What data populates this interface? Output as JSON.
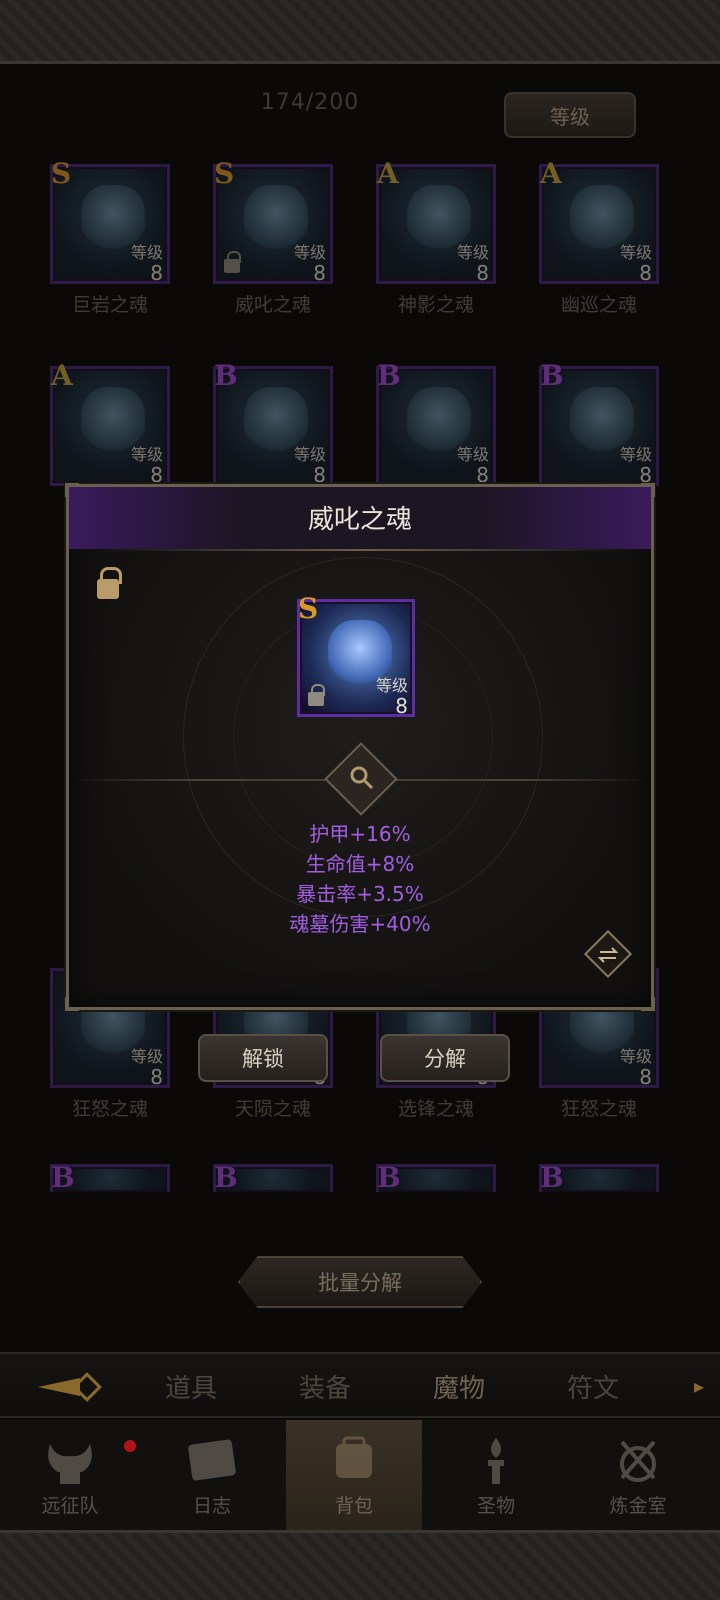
{
  "header": {
    "count": "174/200",
    "sort_label": "等级"
  },
  "grid": {
    "rows": [
      [
        {
          "rank": "S",
          "level_label": "等级",
          "level": "8",
          "name": "巨岩之魂",
          "locked": false
        },
        {
          "rank": "S",
          "level_label": "等级",
          "level": "8",
          "name": "威叱之魂",
          "locked": true
        },
        {
          "rank": "A",
          "level_label": "等级",
          "level": "8",
          "name": "神影之魂",
          "locked": false
        },
        {
          "rank": "A",
          "level_label": "等级",
          "level": "8",
          "name": "幽巡之魂",
          "locked": false
        }
      ],
      [
        {
          "rank": "A",
          "level_label": "等级",
          "level": "8",
          "name": "",
          "locked": false
        },
        {
          "rank": "B",
          "level_label": "等级",
          "level": "8",
          "name": "",
          "locked": false
        },
        {
          "rank": "B",
          "level_label": "等级",
          "level": "8",
          "name": "",
          "locked": false
        },
        {
          "rank": "B",
          "level_label": "等级",
          "level": "8",
          "name": "",
          "locked": false
        }
      ],
      [
        {
          "rank": "",
          "level_label": "等级",
          "level": "8",
          "name": "狂怒之魂",
          "locked": false
        },
        {
          "rank": "",
          "level_label": "",
          "level": "8",
          "name": "天陨之魂",
          "locked": false
        },
        {
          "rank": "",
          "level_label": "",
          "level": "8",
          "name": "选锋之魂",
          "locked": false
        },
        {
          "rank": "",
          "level_label": "等级",
          "level": "8",
          "name": "狂怒之魂",
          "locked": false
        }
      ],
      [
        {
          "rank": "B"
        },
        {
          "rank": "B"
        },
        {
          "rank": "B"
        },
        {
          "rank": "B"
        }
      ]
    ]
  },
  "dialog": {
    "title": "威叱之魂",
    "card": {
      "rank": "S",
      "level_label": "等级",
      "level": "8"
    },
    "stats": [
      "护甲+16%",
      "生命值+8%",
      "暴击率+3.5%",
      "魂墓伤害+40%"
    ]
  },
  "actions": {
    "unlock_label": "解锁",
    "decompose_label": "分解",
    "batch_label": "批量分解"
  },
  "tabs": {
    "items": [
      "道具",
      "装备",
      "魔物",
      "符文"
    ],
    "active": "魔物"
  },
  "nav": {
    "items": [
      "远征队",
      "日志",
      "背包",
      "圣物",
      "炼金室"
    ],
    "active": "背包"
  },
  "colors": {
    "stat": "#a25ee0",
    "rank_s": "#d99a28",
    "rank_b": "#a64bd6",
    "frame": "#6b5f4f"
  }
}
